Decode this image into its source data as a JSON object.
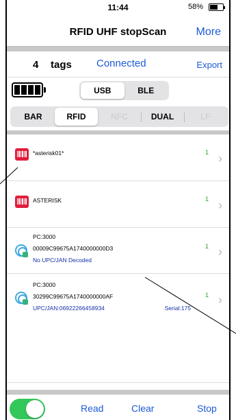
{
  "status_bar": {
    "time": "11:44",
    "battery": "58%"
  },
  "nav": {
    "title": "RFID UHF stopScan",
    "more_label": "More"
  },
  "header": {
    "tag_count": "4",
    "tag_unit": "tags",
    "connection_status": "Connected",
    "export_label": "Export"
  },
  "connection": {
    "options": [
      "USB",
      "BLE"
    ],
    "selected": "USB",
    "battery_icon": "battery-full-icon"
  },
  "modes": {
    "options": [
      "BAR",
      "RFID",
      "NFC",
      "DUAL",
      "LF"
    ],
    "selected": "RFID",
    "disabled": [
      "NFC",
      "LF"
    ]
  },
  "tags": [
    {
      "icon": "barcode-icon",
      "line1": "*asterisk01*",
      "count": "1"
    },
    {
      "icon": "barcode-icon",
      "line1": "ASTERISK",
      "count": "1"
    },
    {
      "icon": "rfid-tag-icon",
      "pc": "PC:3000",
      "epc": "00009C99675A1740000000D3",
      "upc": "No UPC/JAN Decoded",
      "count": "1"
    },
    {
      "icon": "rfid-tag-icon",
      "pc": "PC:3000",
      "epc": "30299C99675A1740000000AF",
      "upc": "UPC/JAN:06922266458934",
      "serial": "Serial:175",
      "count": "1"
    }
  ],
  "toolbar": {
    "toggle_on": true,
    "read_label": "Read",
    "clear_label": "Clear",
    "stop_label": "Stop"
  },
  "colors": {
    "accent": "#1a5ad8",
    "count_green": "#2e9d2e",
    "toggle_green": "#34c759",
    "barcode_red": "#e11d3c",
    "rfid_blue": "#3ca9e2"
  }
}
